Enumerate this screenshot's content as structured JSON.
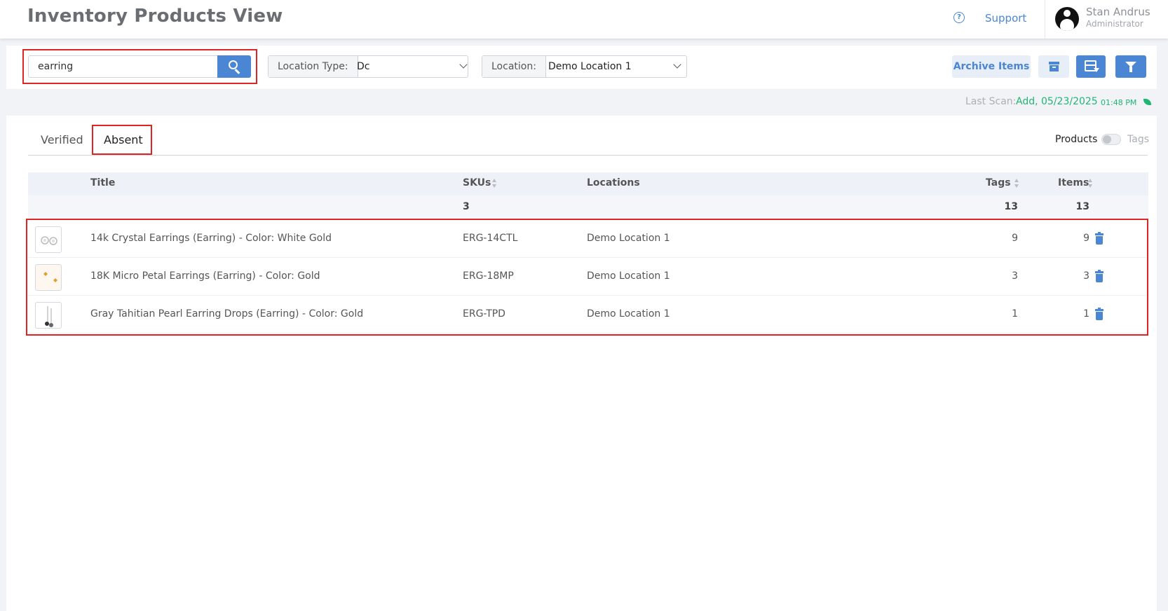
{
  "header": {
    "title": "Inventory Products View",
    "support_label": "Support",
    "help_icon": "question-circle-icon",
    "user": {
      "name": "Stan Andrus",
      "role": "Administrator"
    }
  },
  "toolbar": {
    "search_value": "earring",
    "location_type_label": "Location Type:",
    "location_type_value": "Dc",
    "location_label": "Location:",
    "location_value": "Demo Location 1",
    "archive_items_label": "Archive Items"
  },
  "scan": {
    "label": "Last Scan:",
    "value": "Add, 05/23/2025",
    "time": "01:48 PM"
  },
  "tabs": [
    {
      "label": "Verified",
      "active": false
    },
    {
      "label": "Absent",
      "active": true
    }
  ],
  "view_toggle": {
    "left_label": "Products",
    "right_label": "Tags",
    "value": "Products"
  },
  "table": {
    "columns": [
      "Title",
      "SKUs",
      "Locations",
      "Tags",
      "Items"
    ],
    "totals": {
      "skus": "3",
      "tags": "13",
      "items": "13"
    },
    "rows": [
      {
        "title": "14k Crystal Earrings (Earring) - Color: White Gold",
        "sku": "ERG-14CTL",
        "location": "Demo Location 1",
        "tags": "9",
        "items": "9"
      },
      {
        "title": "18K Micro Petal Earrings (Earring) - Color: Gold",
        "sku": "ERG-18MP",
        "location": "Demo Location 1",
        "tags": "3",
        "items": "3"
      },
      {
        "title": "Gray Tahitian Pearl Earring Drops (Earring) - Color: Gold",
        "sku": "ERG-TPD",
        "location": "Demo Location 1",
        "tags": "1",
        "items": "1"
      }
    ]
  },
  "colors": {
    "accent": "#4a86d4",
    "highlight": "#e02424",
    "success": "#22b573"
  }
}
